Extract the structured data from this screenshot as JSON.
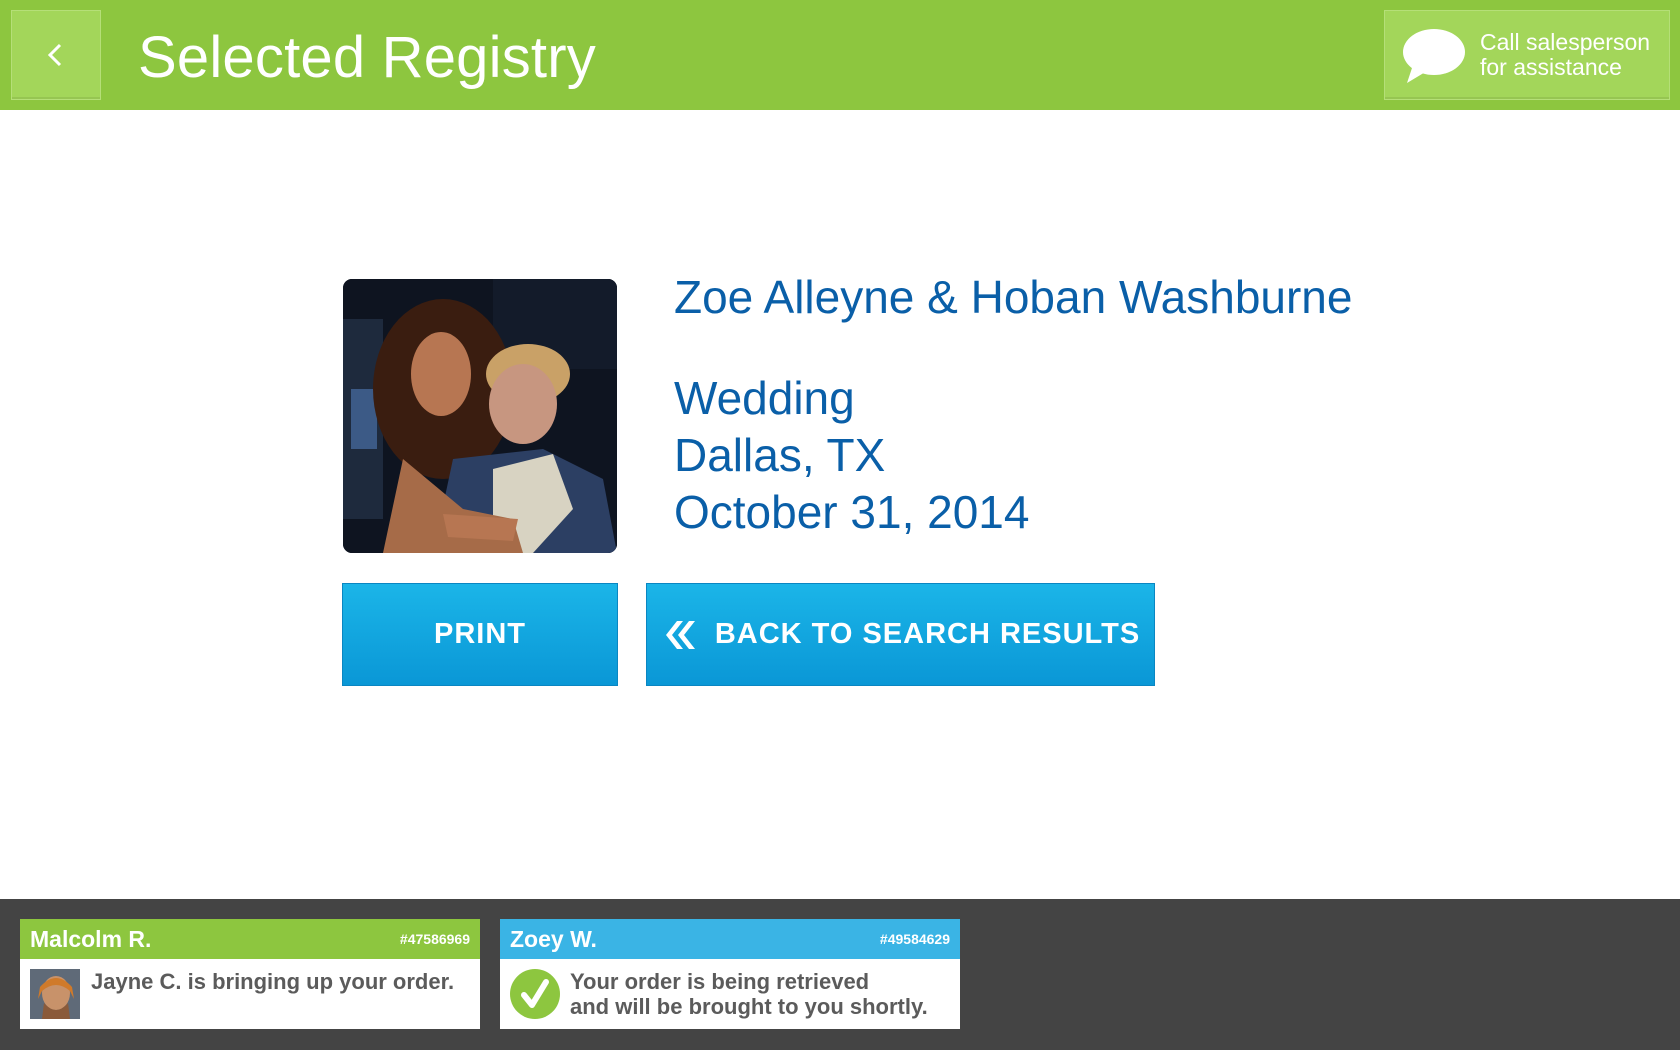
{
  "header": {
    "title": "Selected Registry",
    "back_icon": "chevron-left-icon",
    "assistance": {
      "icon": "speech-bubble-icon",
      "line1": "Call salesperson",
      "line2": "for assistance"
    }
  },
  "registry": {
    "names": "Zoe Alleyne & Hoban Washburne",
    "event_type": "Wedding",
    "location": "Dallas, TX",
    "date": "October 31, 2014"
  },
  "actions": {
    "print_label": "PRINT",
    "back_label": "BACK TO SEARCH RESULTS",
    "back_icon": "double-chevron-left-icon"
  },
  "notifications": [
    {
      "name": "Malcolm R.",
      "order": "#47586969",
      "line1": "Jayne C. is bringing up your order.",
      "line2": "",
      "color": "#8dc63f"
    },
    {
      "name": "Zoey W.",
      "order": "#49584629",
      "line1": "Your order is being retrieved",
      "line2": "and will be brought to you shortly.",
      "color": "#3ab4e5",
      "icon": "checkmark-icon"
    }
  ],
  "colors": {
    "header_green": "#8dc63f",
    "accent_blue": "#0a5fa8",
    "button_blue": "#1bb5e8",
    "footer_gray": "#444444"
  }
}
